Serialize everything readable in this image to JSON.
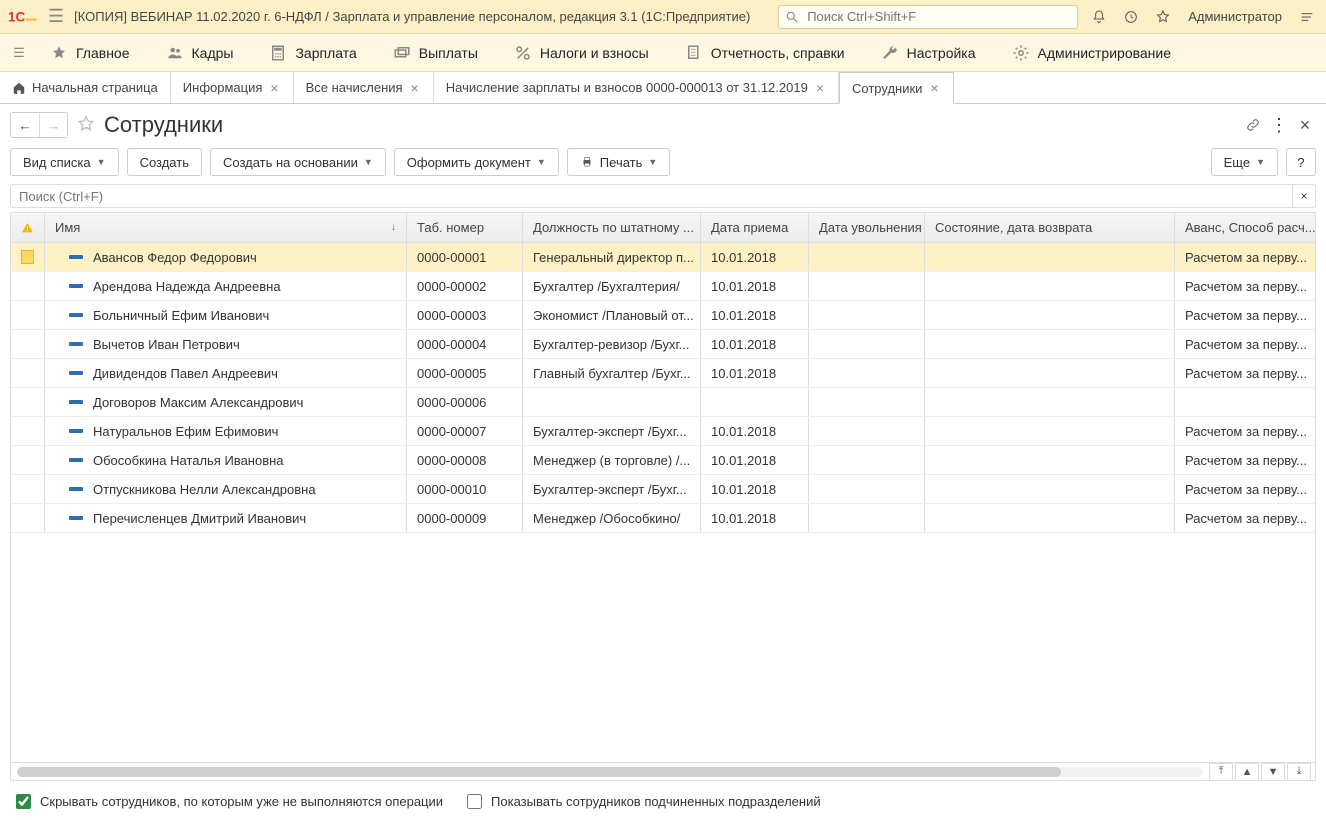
{
  "titlebar": {
    "title": "[КОПИЯ] ВЕБИНАР 11.02.2020 г. 6-НДФЛ / Зарплата и управление персоналом, редакция 3.1  (1С:Предприятие)",
    "search_placeholder": "Поиск Ctrl+Shift+F",
    "user": "Администратор"
  },
  "mainmenu": [
    {
      "label": "Главное",
      "icon": "star"
    },
    {
      "label": "Кадры",
      "icon": "people"
    },
    {
      "label": "Зарплата",
      "icon": "calc"
    },
    {
      "label": "Выплаты",
      "icon": "money"
    },
    {
      "label": "Налоги и взносы",
      "icon": "percent"
    },
    {
      "label": "Отчетность, справки",
      "icon": "report"
    },
    {
      "label": "Настройка",
      "icon": "wrench"
    },
    {
      "label": "Администрирование",
      "icon": "gear"
    }
  ],
  "tabs": [
    {
      "label": "Начальная страница",
      "closable": false,
      "home": true
    },
    {
      "label": "Информация",
      "closable": true
    },
    {
      "label": "Все начисления",
      "closable": true
    },
    {
      "label": "Начисление зарплаты и взносов 0000-000013 от 31.12.2019",
      "closable": true
    },
    {
      "label": "Сотрудники",
      "closable": true,
      "active": true
    }
  ],
  "page": {
    "title": "Сотрудники"
  },
  "toolbar": {
    "view_mode": "Вид списка",
    "create": "Создать",
    "create_based": "Создать на основании",
    "make_doc": "Оформить документ",
    "print": "Печать",
    "more": "Еще",
    "help": "?"
  },
  "table_search_placeholder": "Поиск (Ctrl+F)",
  "columns": {
    "name": "Имя",
    "tab": "Таб. номер",
    "position": "Должность по штатному ...",
    "hired": "Дата приема",
    "fired": "Дата увольнения",
    "state": "Состояние, дата возврата",
    "advance": "Аванс, Способ расч..."
  },
  "rows": [
    {
      "name": "Авансов Федор Федорович",
      "tab": "0000-00001",
      "position": "Генеральный директор п...",
      "hired": "10.01.2018",
      "advance": "Расчетом за перву...",
      "selected": true
    },
    {
      "name": "Арендова Надежда Андреевна",
      "tab": "0000-00002",
      "position": "Бухгалтер /Бухгалтерия/",
      "hired": "10.01.2018",
      "advance": "Расчетом за перву..."
    },
    {
      "name": "Больничный Ефим Иванович",
      "tab": "0000-00003",
      "position": "Экономист /Плановый от...",
      "hired": "10.01.2018",
      "advance": "Расчетом за перву..."
    },
    {
      "name": "Вычетов Иван Петрович",
      "tab": "0000-00004",
      "position": "Бухгалтер-ревизор /Бухг...",
      "hired": "10.01.2018",
      "advance": "Расчетом за перву..."
    },
    {
      "name": "Дивидендов Павел Андреевич",
      "tab": "0000-00005",
      "position": "Главный бухгалтер /Бухг...",
      "hired": "10.01.2018",
      "advance": "Расчетом за перву..."
    },
    {
      "name": "Договоров Максим Александрович",
      "tab": "0000-00006",
      "position": "",
      "hired": "",
      "advance": ""
    },
    {
      "name": "Натуральнов Ефим Ефимович",
      "tab": "0000-00007",
      "position": "Бухгалтер-эксперт /Бухг...",
      "hired": "10.01.2018",
      "advance": "Расчетом за перву..."
    },
    {
      "name": "Обособкина Наталья Ивановна",
      "tab": "0000-00008",
      "position": "Менеджер (в торговле) /...",
      "hired": "10.01.2018",
      "advance": "Расчетом за перву..."
    },
    {
      "name": "Отпускникова Нелли Александровна",
      "tab": "0000-00010",
      "position": "Бухгалтер-эксперт /Бухг...",
      "hired": "10.01.2018",
      "advance": "Расчетом за перву..."
    },
    {
      "name": "Перечисленцев Дмитрий Иванович",
      "tab": "0000-00009",
      "position": "Менеджер /Обособкино/",
      "hired": "10.01.2018",
      "advance": "Расчетом за перву..."
    }
  ],
  "footer": {
    "hide_inactive": "Скрывать сотрудников, по которым уже не выполняются операции",
    "show_sub": "Показывать сотрудников подчиненных подразделений",
    "hide_inactive_checked": true,
    "show_sub_checked": false
  }
}
